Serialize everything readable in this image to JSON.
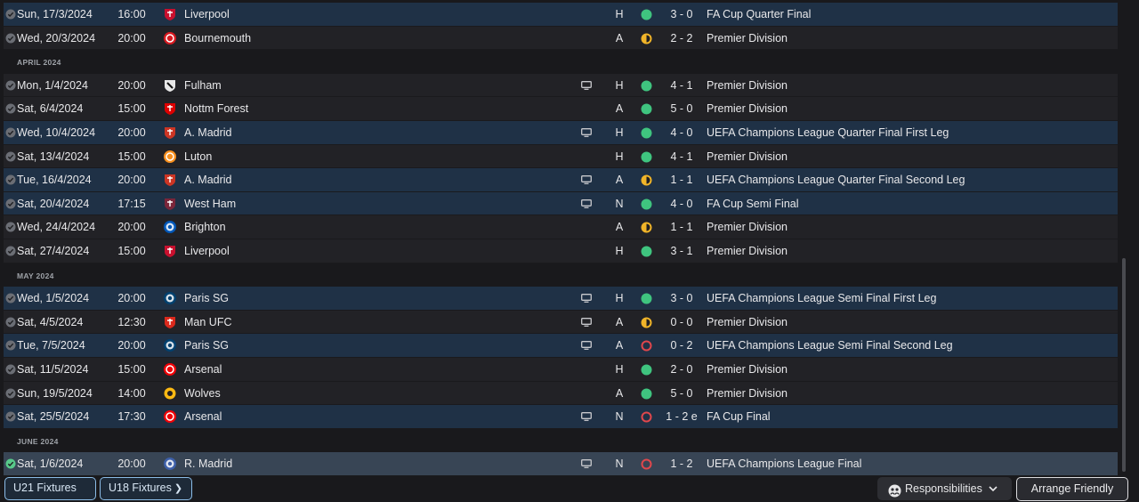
{
  "months": [
    "APRIL 2024",
    "MAY 2024",
    "JUNE 2024"
  ],
  "rows_a": [
    {
      "date": "Sun, 17/3/2024",
      "time": "16:00",
      "team": "Liverpool",
      "crest": "liverpool-crest-icon",
      "crest_color": "#c8102e",
      "tv": false,
      "venue": "H",
      "result": "win",
      "score": "3 - 0",
      "competition": "FA Cup Quarter Final",
      "highlight": true
    },
    {
      "date": "Wed, 20/3/2024",
      "time": "20:00",
      "team": "Bournemouth",
      "crest": "bournemouth-crest-icon",
      "crest_color": "#d71920",
      "tv": false,
      "venue": "A",
      "result": "draw",
      "score": "2 - 2",
      "competition": "Premier Division",
      "highlight": false
    }
  ],
  "rows_b": [
    {
      "date": "Mon, 1/4/2024",
      "time": "20:00",
      "team": "Fulham",
      "crest": "fulham-crest-icon",
      "crest_color": "#e8e8e8",
      "tv": true,
      "venue": "H",
      "result": "win",
      "score": "4 - 1",
      "competition": "Premier Division",
      "highlight": false
    },
    {
      "date": "Sat, 6/4/2024",
      "time": "15:00",
      "team": "Nottm Forest",
      "crest": "nottm-forest-crest-icon",
      "crest_color": "#dd0000",
      "tv": false,
      "venue": "A",
      "result": "win",
      "score": "5 - 0",
      "competition": "Premier Division",
      "highlight": false
    },
    {
      "date": "Wed, 10/4/2024",
      "time": "20:00",
      "team": "A. Madrid",
      "crest": "atletico-madrid-crest-icon",
      "crest_color": "#cb3524",
      "tv": true,
      "venue": "H",
      "result": "win",
      "score": "4 - 0",
      "competition": "UEFA Champions League Quarter Final First Leg",
      "highlight": true
    },
    {
      "date": "Sat, 13/4/2024",
      "time": "15:00",
      "team": "Luton",
      "crest": "luton-crest-icon",
      "crest_color": "#f78f1e",
      "tv": false,
      "venue": "H",
      "result": "win",
      "score": "4 - 1",
      "competition": "Premier Division",
      "highlight": false
    },
    {
      "date": "Tue, 16/4/2024",
      "time": "20:00",
      "team": "A. Madrid",
      "crest": "atletico-madrid-crest-icon",
      "crest_color": "#cb3524",
      "tv": true,
      "venue": "A",
      "result": "draw",
      "score": "1 - 1",
      "competition": "UEFA Champions League Quarter Final Second Leg",
      "highlight": true
    },
    {
      "date": "Sat, 20/4/2024",
      "time": "17:15",
      "team": "West Ham",
      "crest": "west-ham-crest-icon",
      "crest_color": "#7a263a",
      "tv": true,
      "venue": "N",
      "result": "win",
      "score": "4 - 0",
      "competition": "FA Cup Semi Final",
      "highlight": true
    },
    {
      "date": "Wed, 24/4/2024",
      "time": "20:00",
      "team": "Brighton",
      "crest": "brighton-crest-icon",
      "crest_color": "#0057b8",
      "tv": false,
      "venue": "A",
      "result": "draw",
      "score": "1 - 1",
      "competition": "Premier Division",
      "highlight": false
    },
    {
      "date": "Sat, 27/4/2024",
      "time": "15:00",
      "team": "Liverpool",
      "crest": "liverpool-crest-icon",
      "crest_color": "#c8102e",
      "tv": false,
      "venue": "H",
      "result": "win",
      "score": "3 - 1",
      "competition": "Premier Division",
      "highlight": false
    }
  ],
  "rows_c": [
    {
      "date": "Wed, 1/5/2024",
      "time": "20:00",
      "team": "Paris SG",
      "crest": "psg-crest-icon",
      "crest_color": "#004170",
      "tv": true,
      "venue": "H",
      "result": "win",
      "score": "3 - 0",
      "competition": "UEFA Champions League Semi Final First Leg",
      "highlight": true
    },
    {
      "date": "Sat, 4/5/2024",
      "time": "12:30",
      "team": "Man UFC",
      "crest": "man-utd-crest-icon",
      "crest_color": "#da291c",
      "tv": true,
      "venue": "A",
      "result": "draw",
      "score": "0 - 0",
      "competition": "Premier Division",
      "highlight": false
    },
    {
      "date": "Tue, 7/5/2024",
      "time": "20:00",
      "team": "Paris SG",
      "crest": "psg-crest-icon",
      "crest_color": "#004170",
      "tv": true,
      "venue": "A",
      "result": "loss",
      "score": "0 - 2",
      "competition": "UEFA Champions League Semi Final Second Leg",
      "highlight": true
    },
    {
      "date": "Sat, 11/5/2024",
      "time": "15:00",
      "team": "Arsenal",
      "crest": "arsenal-crest-icon",
      "crest_color": "#ef0107",
      "tv": false,
      "venue": "H",
      "result": "win",
      "score": "2 - 0",
      "competition": "Premier Division",
      "highlight": false
    },
    {
      "date": "Sun, 19/5/2024",
      "time": "14:00",
      "team": "Wolves",
      "crest": "wolves-crest-icon",
      "crest_color": "#fdb913",
      "tv": false,
      "venue": "A",
      "result": "win",
      "score": "5 - 0",
      "competition": "Premier Division",
      "highlight": false
    },
    {
      "date": "Sat, 25/5/2024",
      "time": "17:30",
      "team": "Arsenal",
      "crest": "arsenal-crest-icon",
      "crest_color": "#ef0107",
      "tv": true,
      "venue": "N",
      "result": "loss",
      "score": "1 - 2 e",
      "competition": "FA Cup Final",
      "highlight": true
    }
  ],
  "rows_d": [
    {
      "date": "Sat, 1/6/2024",
      "time": "20:00",
      "team": "R. Madrid",
      "crest": "real-madrid-crest-icon",
      "crest_color": "#3d5fa8",
      "tv": true,
      "venue": "N",
      "result": "loss",
      "score": "1 - 2",
      "competition": "UEFA Champions League Final",
      "highlight": "last"
    }
  ],
  "result_colors": {
    "win": "#3fc47f",
    "draw": "#f0b429",
    "loss": "#e0474c"
  },
  "footer": {
    "u21_label": "U21 Fixtures",
    "u18_label": "U18 Fixtures",
    "responsibilities_label": "Responsibilities",
    "arrange_label": "Arrange Friendly"
  }
}
